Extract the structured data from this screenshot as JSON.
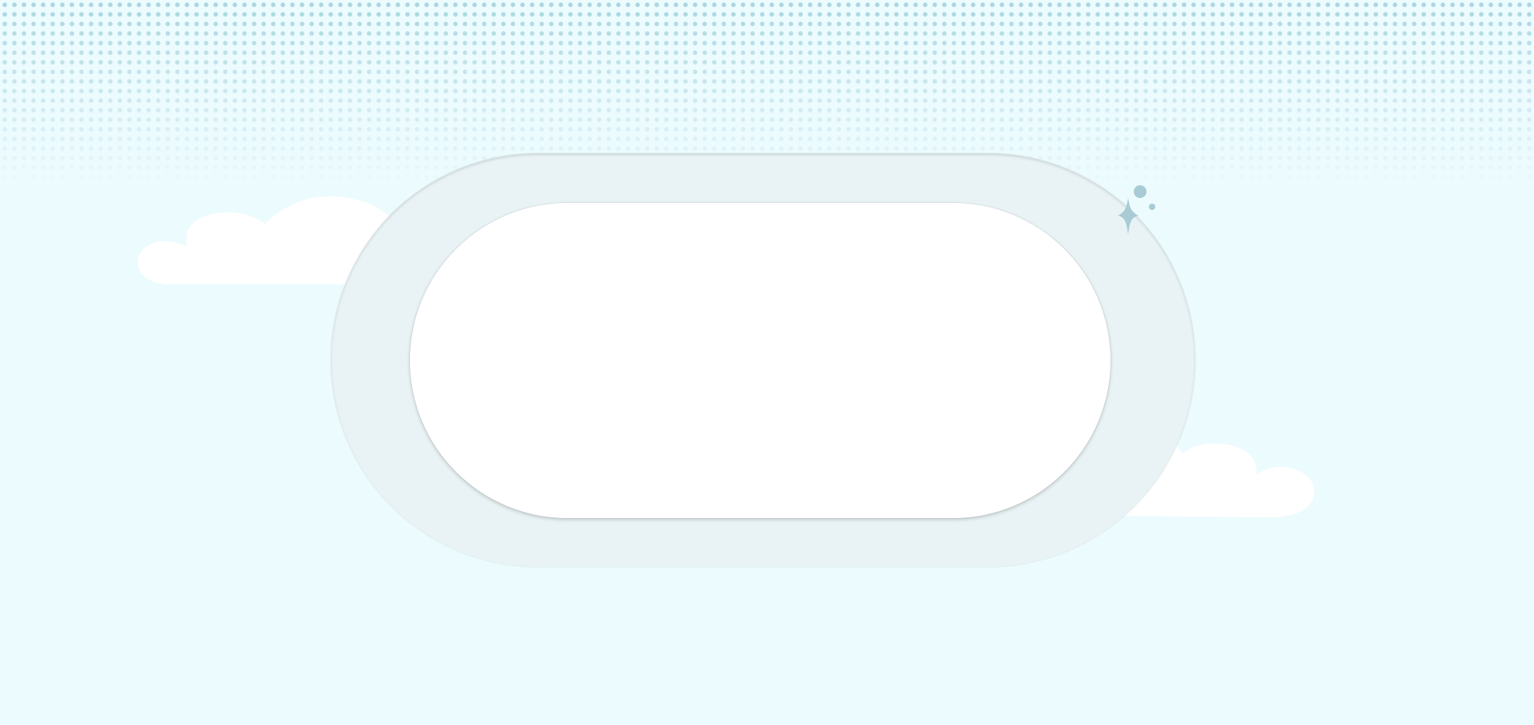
{
  "scene": {
    "background_color": "#ecfbfe",
    "dot_pattern_color": "#a9d5e0",
    "cloud_color": "#ffffff",
    "outer_frame_color": "#e9f3f5",
    "inner_panel_color": "#ffffff",
    "sparkle_color": "#a8cbd5"
  },
  "icons": {
    "sparkle": "sparkle-icon",
    "cloud_left": "cloud-icon",
    "cloud_right": "cloud-icon"
  }
}
